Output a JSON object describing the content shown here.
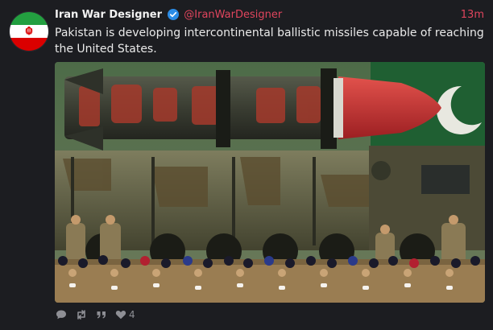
{
  "author": {
    "display_name": "Iran War Designer",
    "handle": "@IranWarDesigner",
    "verified_icon": "verified-badge-icon",
    "avatar_icon": "iran-flag-avatar"
  },
  "post": {
    "time": "13m",
    "text": "Pakistan is developing intercontinental ballistic missiles capable of reaching the United States.",
    "media": {
      "description_icon": "missile-parade-photo"
    }
  },
  "actions": {
    "reply_icon": "reply-icon",
    "boost_icon": "boost-icon",
    "quote_icon": "quote-icon",
    "like_icon": "heart-icon",
    "like_count": "4"
  },
  "colors": {
    "accent": "#e0455d",
    "background": "#1c1d21",
    "verified": "#2b8ce6"
  }
}
